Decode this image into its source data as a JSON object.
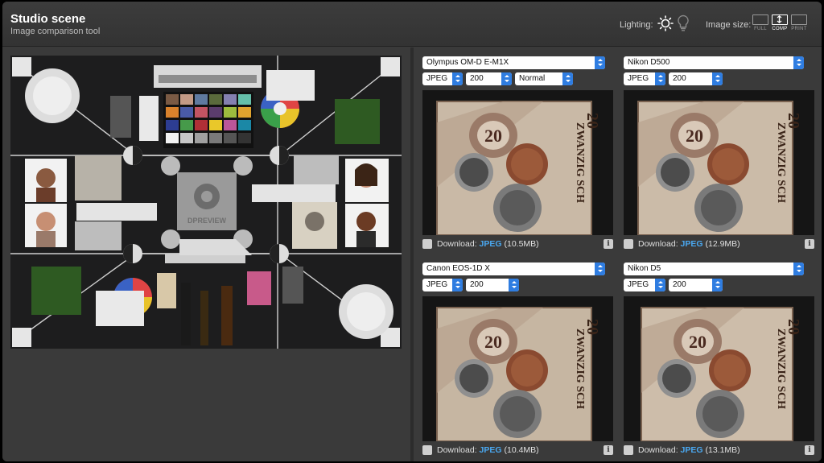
{
  "header": {
    "title": "Studio scene",
    "subtitle": "Image comparison tool",
    "lighting_label": "Lighting:",
    "image_size_label": "Image size:",
    "size_options": [
      {
        "label": "FULL",
        "active": false
      },
      {
        "label": "COMP",
        "active": true
      },
      {
        "label": "PRINT",
        "active": false
      }
    ]
  },
  "scene": {
    "chart_label": "DPREVIEW"
  },
  "cameras": [
    {
      "camera": "Olympus OM-D E-M1X",
      "format": "JPEG",
      "iso": "200",
      "mode": "Normal",
      "download_label": "Download:",
      "download_format": "JPEG",
      "download_size": "(10.5MB)"
    },
    {
      "camera": "Nikon D500",
      "format": "JPEG",
      "iso": "200",
      "mode": null,
      "download_label": "Download:",
      "download_format": "JPEG",
      "download_size": "(12.9MB)"
    },
    {
      "camera": "Canon EOS-1D X",
      "format": "JPEG",
      "iso": "200",
      "mode": null,
      "download_label": "Download:",
      "download_format": "JPEG",
      "download_size": "(10.4MB)"
    },
    {
      "camera": "Nikon D5",
      "format": "JPEG",
      "iso": "200",
      "mode": null,
      "download_label": "Download:",
      "download_format": "JPEG",
      "download_size": "(13.1MB)"
    }
  ],
  "crop_content": {
    "banknote_number": "20",
    "banknote_text": "ZWANZIG SCH"
  },
  "colors": {
    "accent_blue": "#2f7de1",
    "format_link": "#4aa8f0"
  }
}
